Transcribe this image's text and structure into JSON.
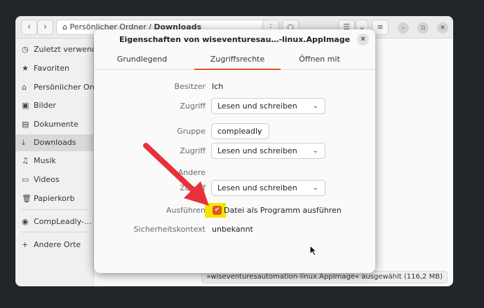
{
  "file_manager": {
    "nav": {
      "back_icon": "chevron-left-icon",
      "forward_icon": "chevron-right-icon"
    },
    "path": {
      "home_label": "Persönlicher Ordner",
      "separator": "/",
      "current": "Downloads"
    },
    "sidebar": {
      "items": [
        {
          "label": "Zuletzt verwendet",
          "icon": "clock-icon"
        },
        {
          "label": "Favoriten",
          "icon": "star-icon"
        },
        {
          "label": "Persönlicher Ordner",
          "icon": "home-icon"
        },
        {
          "label": "Bilder",
          "icon": "image-icon"
        },
        {
          "label": "Dokumente",
          "icon": "document-icon"
        },
        {
          "label": "Downloads",
          "icon": "download-icon",
          "active": true
        },
        {
          "label": "Musik",
          "icon": "music-icon"
        },
        {
          "label": "Videos",
          "icon": "video-icon"
        },
        {
          "label": "Papierkorb",
          "icon": "trash-icon"
        },
        {
          "label": "CompLeadly-...",
          "icon": "disc-icon"
        },
        {
          "label": "Andere Orte",
          "icon": "plus-icon"
        }
      ]
    },
    "statusbar": "»wiseventuresautomation-linux.AppImage« ausgewählt  (116,2 MB)"
  },
  "dialog": {
    "title": "Eigenschaften von wiseventuresau…-linux.AppImage",
    "tabs": [
      {
        "label": "Grundlegend"
      },
      {
        "label": "Zugriffsrechte",
        "active": true
      },
      {
        "label": "Öffnen mit"
      }
    ],
    "owner": {
      "label": "Besitzer",
      "value": "Ich"
    },
    "owner_access": {
      "label": "Zugriff",
      "value": "Lesen und schreiben"
    },
    "group": {
      "label": "Gruppe",
      "value": "compleadly"
    },
    "group_access": {
      "label": "Zugriff",
      "value": "Lesen und schreiben"
    },
    "others": {
      "label": "Andere"
    },
    "others_access": {
      "label": "Zugriff",
      "value": "Lesen und schreiben"
    },
    "execute": {
      "label": "Ausführen",
      "checkbox_label": "Datei als Programm ausführen",
      "checked": true
    },
    "security": {
      "label": "Sicherheitskontext",
      "value": "unbekannt"
    }
  },
  "colors": {
    "accent": "#e95420",
    "highlight": "#f4e600",
    "annotation_arrow": "#e8313b"
  }
}
